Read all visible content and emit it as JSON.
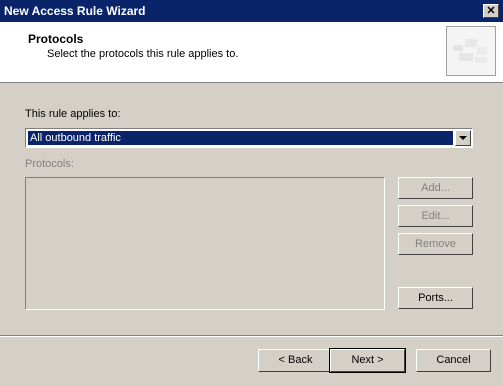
{
  "window": {
    "title": "New Access Rule Wizard",
    "close_label": "✕"
  },
  "header": {
    "title": "Protocols",
    "subtitle": "Select the protocols this rule applies to."
  },
  "applies": {
    "label": "This rule applies to:",
    "selected": "All outbound traffic"
  },
  "protocols": {
    "label": "Protocols:"
  },
  "side_buttons": {
    "add": "Add...",
    "edit": "Edit...",
    "remove": "Remove",
    "ports": "Ports..."
  },
  "footer": {
    "back": "< Back",
    "next": "Next >",
    "cancel": "Cancel"
  },
  "icons": [
    "close-icon",
    "dropdown-arrow-icon",
    "wizard-header-icon"
  ]
}
